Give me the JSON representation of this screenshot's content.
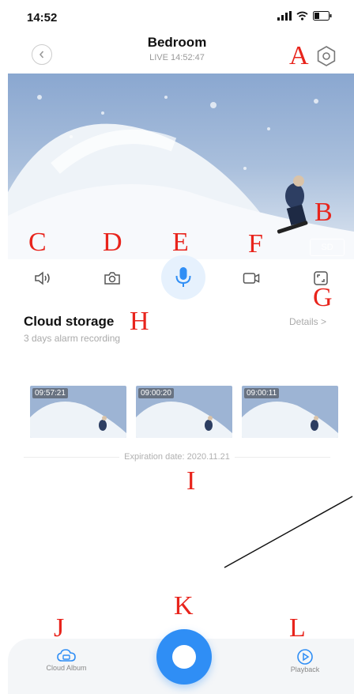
{
  "status_bar": {
    "time": "14:52"
  },
  "header": {
    "title": "Bedroom",
    "subtitle": "LIVE 14:52:47"
  },
  "video": {
    "quality_badge": "SD"
  },
  "controls": {
    "icons": [
      "speaker-icon",
      "camera-icon",
      "microphone-icon",
      "record-video-icon",
      "fullscreen-icon"
    ],
    "accent_color": "#2f8ef5"
  },
  "cloud_storage": {
    "title": "Cloud storage",
    "subtitle": "3 days alarm recording",
    "details_label": "Details",
    "clips": [
      {
        "time": "09:57:21"
      },
      {
        "time": "09:00:20"
      },
      {
        "time": "09:00:11"
      }
    ],
    "expiration": "Expiration date: 2020.11.21"
  },
  "bottom_nav": {
    "cloud_album_label": "Cloud Album",
    "playback_label": "Playback"
  },
  "annotations": {
    "A": "A",
    "B": "B",
    "C": "C",
    "D": "D",
    "E": "E",
    "F": "F",
    "G": "G",
    "H": "H",
    "I": "I",
    "J": "J",
    "K": "K",
    "L": "L"
  }
}
